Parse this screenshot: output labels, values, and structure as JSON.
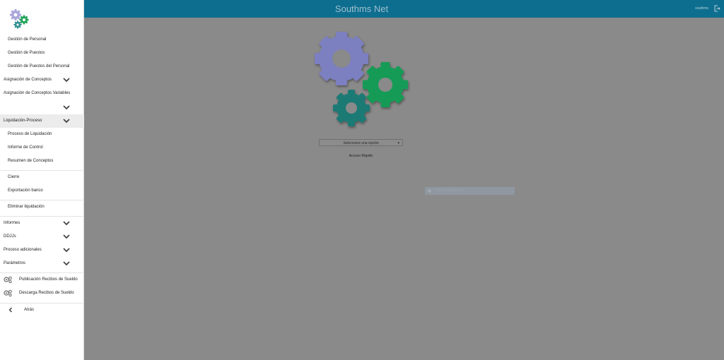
{
  "app": {
    "title": "Southms Net",
    "user": "southms"
  },
  "sidebar": {
    "items": [
      {
        "label": "Gestión de Personal"
      },
      {
        "label": "Gestión de Puestos"
      },
      {
        "label": "Gestión de Puestos del Personal"
      },
      {
        "label": "Asignación de Conceptos"
      },
      {
        "label": "Asignación de Conceptos Variables"
      },
      {
        "label": ""
      },
      {
        "label": "Liquidación-Proceso"
      },
      {
        "label": "Proceso de Liquidación"
      },
      {
        "label": "Informe de Control"
      },
      {
        "label": "Resumen de Conceptos"
      },
      {
        "label": "Cierre"
      },
      {
        "label": "Exportación banco"
      },
      {
        "label": "Eliminar liquidación"
      },
      {
        "label": "Informes"
      },
      {
        "label": "DDJJs"
      },
      {
        "label": "Proceso adicionales"
      },
      {
        "label": "Parámetros"
      },
      {
        "label": "Publicación Recibos de Sueldo"
      },
      {
        "label": "Descarga Recibos de Sueldo"
      },
      {
        "label": "Atrás"
      }
    ]
  },
  "main": {
    "select": {
      "value": "Seleccione una opción"
    },
    "quick_access": "Acceso Rápido",
    "toast": {
      "text": "Procesar Cálculo"
    }
  },
  "colors": {
    "header": "#0e6e90",
    "gear_purple": "#7b7fc0",
    "gear_green": "#139b57",
    "gear_teal": "#1b7a74"
  }
}
